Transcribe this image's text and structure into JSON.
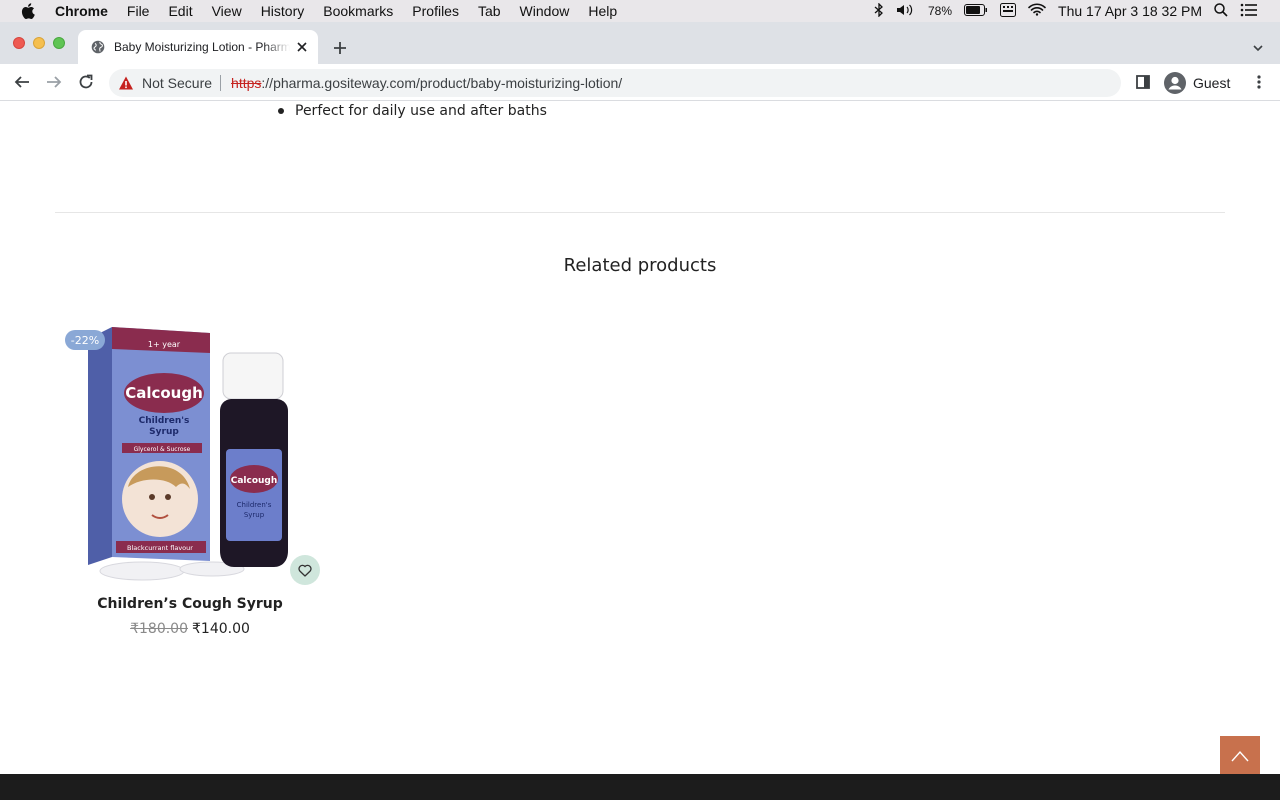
{
  "menubar": {
    "app": "Chrome",
    "items": [
      "File",
      "Edit",
      "View",
      "History",
      "Bookmarks",
      "Profiles",
      "Tab",
      "Window",
      "Help"
    ],
    "battery": "78%",
    "datetime": "Thu 17 Apr  3 18 32 PM",
    "icons": [
      "apple-icon",
      "bluetooth-icon",
      "volume-icon",
      "battery-icon",
      "keyboard-icon",
      "wifi-icon",
      "spotlight-icon",
      "control-center-icon"
    ]
  },
  "browser": {
    "tab_title": "Baby Moisturizing Lotion - Pharma",
    "security_label": "Not Secure",
    "url_scheme": "https",
    "url_rest": "://pharma.gositeway.com/product/baby-moisturizing-lotion/",
    "profile_label": "Guest"
  },
  "page": {
    "bullets": [
      "Perfect for daily use and after baths"
    ],
    "related_title": "Related products",
    "products": [
      {
        "name": "Children’s Cough Syrup",
        "badge": "-22%",
        "old_price": "₹180.00",
        "new_price": "₹140.00",
        "image_text": {
          "brand": "Calcough",
          "line1": "Children's",
          "line2": "Syrup",
          "age": "1+ year",
          "sub": "Glycerol & Sucrose",
          "flavour": "Blackcurrant flavour"
        }
      }
    ]
  },
  "colors": {
    "badge": "#8aa8d6",
    "wishlist_bg": "#cfe6dc",
    "back_to_top": "#c8714d"
  }
}
